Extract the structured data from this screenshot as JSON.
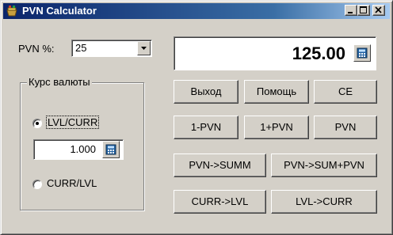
{
  "window": {
    "title": "PVN Calculator",
    "controls": [
      "minimize-icon",
      "maximize-icon",
      "close-icon"
    ]
  },
  "pvn_percent": {
    "label": "PVN %:",
    "value": "25"
  },
  "display": {
    "value": "125.00"
  },
  "currency_group": {
    "title": "Курс валюты",
    "option_lvl_curr": "LVL/CURR",
    "option_curr_lvl": "CURR/LVL",
    "selected": "LVL/CURR",
    "rate_value": "1.000"
  },
  "buttons": {
    "exit": "Выход",
    "help": "Помощь",
    "ce": "CE",
    "one_minus_pvn": "1-PVN",
    "one_plus_pvn": "1+PVN",
    "pvn": "PVN",
    "pvn_to_summ": "PVN->SUMM",
    "pvn_to_sum_plus_pvn": "PVN->SUM+PVN",
    "curr_to_lvl": "CURR->LVL",
    "lvl_to_curr": "LVL->CURR"
  },
  "colors": {
    "title_start": "#0a246a",
    "title_end": "#a6caf0",
    "face": "#d4d0c8"
  }
}
